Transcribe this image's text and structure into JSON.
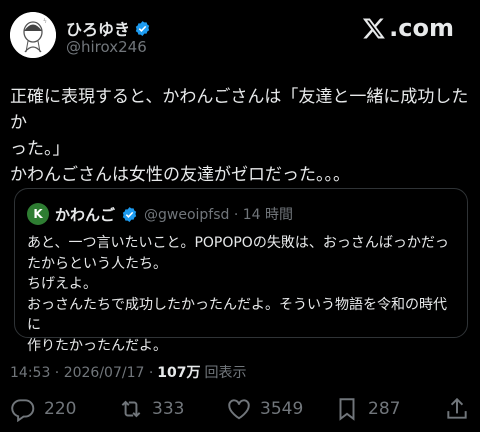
{
  "author": {
    "name": "ひろゆき",
    "handle": "@hirox246"
  },
  "brand": {
    "logo_text": ".com"
  },
  "tweet": {
    "lines": [
      "正確に表現すると、かわんごさんは「友達と一緒に成功したか",
      "った。」",
      "かわんごさんは女性の友達がゼロだった。。。"
    ]
  },
  "quoted": {
    "avatar_letter": "K",
    "name": "かわんご",
    "handle_time": "@gweoipfsd · 14 時間",
    "text": "あと、一つ言いたいこと。POPOPOの失敗は、おっさんばっかだっ\nたからという人たち。\nちげえよ。\nおっさんたちで成功したかったんだよ。そういう物語を令和の時代に\n作りたかったんだよ。"
  },
  "meta": {
    "time": "14:53 · 2026/07/17 ·",
    "views": "107万",
    "views_suffix": "回表示"
  },
  "actions": {
    "replies": "220",
    "reposts": "333",
    "likes": "3549",
    "bookmarks": "287"
  },
  "colors": {
    "background": "#000000",
    "text": "#e7e9ea",
    "muted": "#71767b",
    "verified": "#1d9bf0",
    "border": "#2f3336"
  }
}
